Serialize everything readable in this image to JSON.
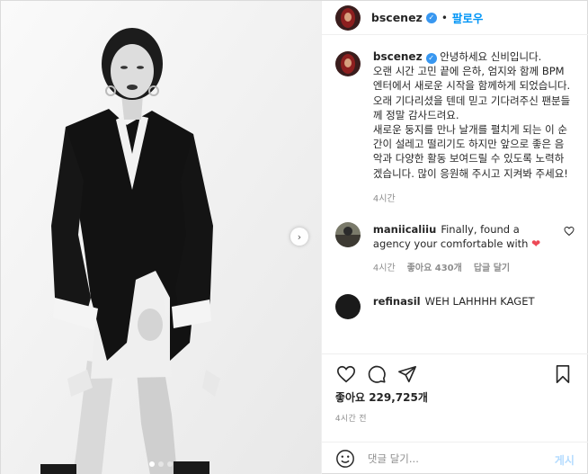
{
  "header": {
    "username": "bscenez",
    "separator": "•",
    "follow_label": "팔로우"
  },
  "caption": {
    "username": "bscenez",
    "text": " 안녕하세요 신비입니다.\n오랜 시간 고민 끝에 은하, 엄지와 함께 BPM 엔터에서 새로운 시작을 함께하게 되었습니다. 오래 기다리셨을 텐데 믿고 기다려주신 팬분들께 정말 감사드려요.\n새로운 둥지를 만나 날개를 펼치게 되는 이 순간이 설레고 떨리기도 하지만 앞으로 좋은 음악과 다양한 활동 보여드릴 수 있도록 노력하겠습니다. 많이 응원해 주시고 지켜봐 주세요!",
    "time": "4시간"
  },
  "comments": [
    {
      "username": "maniicaliiu",
      "text": "Finally, found a agency your comfortable with",
      "emoji": "❤",
      "time": "4시간",
      "likes": "좋아요 430개",
      "reply": "답글 달기"
    },
    {
      "username": "refinasil",
      "text": "WEH LAHHHH KAGET"
    }
  ],
  "likes_count": "좋아요 229,725개",
  "date": "4시간 전",
  "input": {
    "placeholder": "댓글 달기...",
    "post_label": "게시"
  },
  "icons": {
    "verified": "verified-badge-icon",
    "heart": "heart-icon",
    "comment": "comment-icon",
    "share": "share-icon",
    "bookmark": "bookmark-icon",
    "emoji": "emoji-icon",
    "next": "chevron-right-icon"
  },
  "colors": {
    "accent": "#0095f6",
    "verified": "#3897f0",
    "like_red": "#ed4956",
    "muted": "#8e8e8e"
  },
  "carousel": {
    "slides": 3,
    "active": 1
  }
}
